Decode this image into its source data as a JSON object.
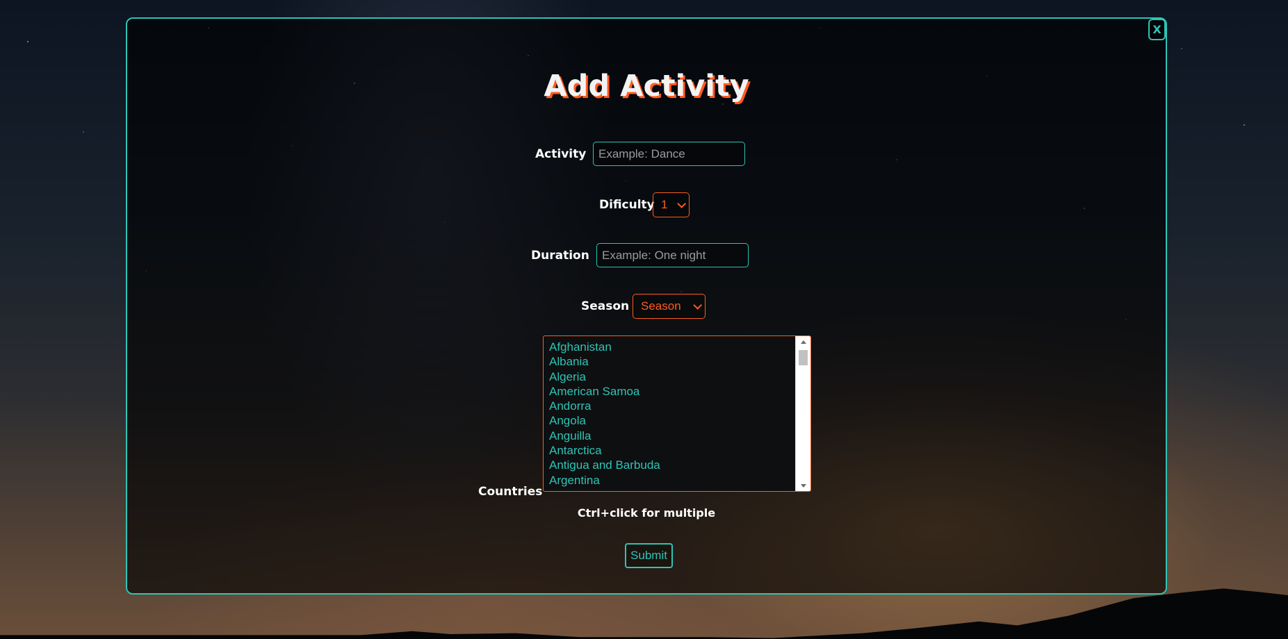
{
  "close_button": {
    "label": "X"
  },
  "form": {
    "title": "Add Activity",
    "activity": {
      "label": "Activity",
      "placeholder": "Example: Dance",
      "value": ""
    },
    "difficulty": {
      "label": "Dificulty",
      "selected": "1"
    },
    "duration": {
      "label": "Duration",
      "placeholder": "Example: One night",
      "value": ""
    },
    "season": {
      "label": "Season",
      "selected": "Season"
    },
    "countries": {
      "label": "Countries",
      "options": [
        "Afghanistan",
        "Albania",
        "Algeria",
        "American Samoa",
        "Andorra",
        "Angola",
        "Anguilla",
        "Antarctica",
        "Antigua and Barbuda",
        "Argentina"
      ],
      "hint": "Ctrl+click for multiple"
    },
    "submit_label": "Submit"
  },
  "colors": {
    "accent_teal": "#2ec4b6",
    "accent_orange": "#ff5c1f",
    "title_text": "#f3f3f3",
    "label_text": "#ffffff"
  },
  "icons": {
    "close": "close-icon",
    "select_arrow": "chevron-down-icon",
    "scroll_up": "arrow-up-icon",
    "scroll_down": "arrow-down-icon"
  }
}
